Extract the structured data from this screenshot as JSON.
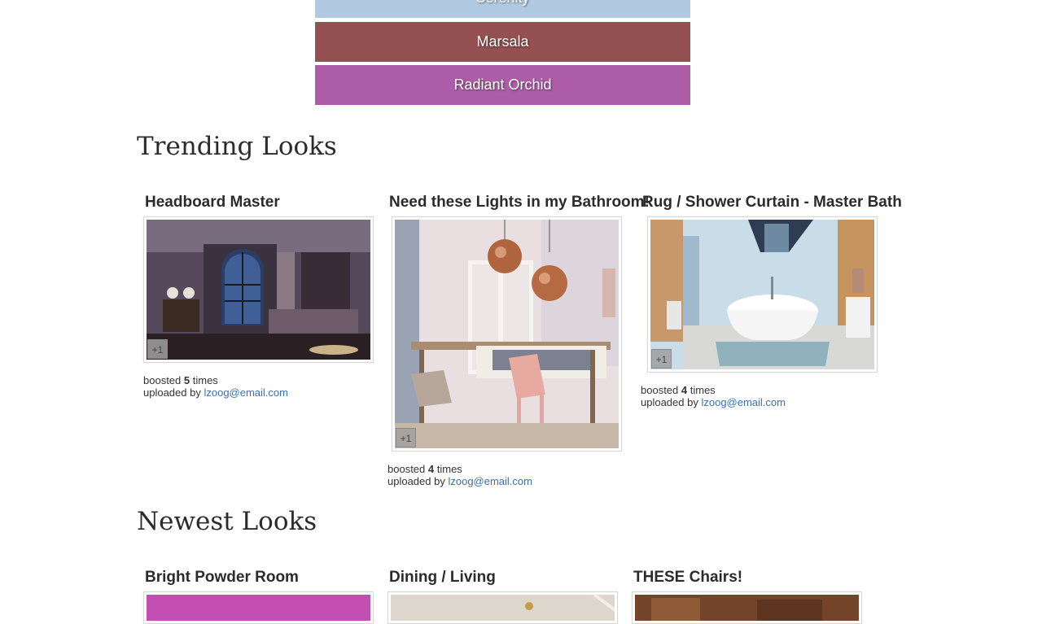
{
  "palette": [
    {
      "label": "Serenity",
      "color": "#b1cae2"
    },
    {
      "label": "Marsala",
      "color": "#955151"
    },
    {
      "label": "Radiant Orchid",
      "color": "#ad5da7"
    }
  ],
  "trending": {
    "title": "Trending Looks",
    "items": [
      {
        "title": "Headboard Master",
        "plus_label": "+1",
        "boosted_prefix": "boosted",
        "boost_count": "5",
        "boosted_suffix": "times",
        "uploaded_prefix": "uploaded by",
        "uploader": "lzoog@email.com"
      },
      {
        "title": "Need these Lights in my Bathroom!",
        "plus_label": "+1",
        "boosted_prefix": "boosted",
        "boost_count": "4",
        "boosted_suffix": "times",
        "uploaded_prefix": "uploaded by",
        "uploader": "lzoog@email.com"
      },
      {
        "title": "Rug / Shower Curtain - Master Bath",
        "plus_label": "+1",
        "boosted_prefix": "boosted",
        "boost_count": "4",
        "boosted_suffix": "times",
        "uploaded_prefix": "uploaded by",
        "uploader": "lzoog@email.com"
      }
    ]
  },
  "newest": {
    "title": "Newest Looks",
    "items": [
      {
        "title": "Bright Powder Room"
      },
      {
        "title": "Dining / Living"
      },
      {
        "title": "THESE Chairs!"
      }
    ]
  }
}
